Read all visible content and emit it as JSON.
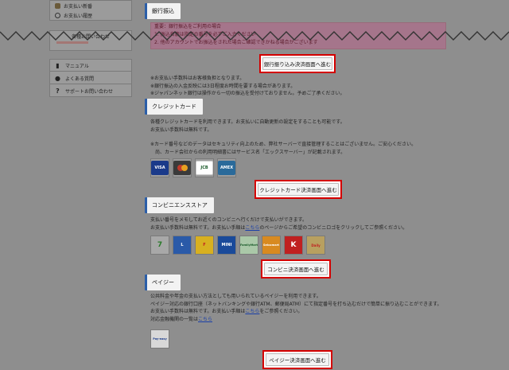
{
  "sidebar": {
    "top_items": [
      {
        "label": "お支払い新番",
        "icon": "wallet-icon"
      },
      {
        "label": "お支払い履歴",
        "icon": "clock-icon"
      }
    ],
    "box_title": "各種お問い合わせ",
    "menu": [
      {
        "label": "マニュアル",
        "icon": "book-icon",
        "glyph": "▮"
      },
      {
        "label": "よくある質問",
        "icon": "speech-bubble-icon",
        "glyph": "●"
      },
      {
        "label": "サポートお問い合わせ",
        "icon": "question-icon",
        "glyph": "?"
      }
    ]
  },
  "bank": {
    "heading": "銀行振込",
    "warning_lines": [
      "重要：銀行振込をご利用の場合",
      "1. 振込名義は指定の番号を必ずご入力ください",
      "2. 他のアカウントでお振込をされた場合ご確認できかねる場合がございます"
    ],
    "button": "銀行振り込み決済画面へ進む",
    "notes": [
      "※お支払い手数料はお客様負担となります。",
      "※銀行振込の入金反映には3日程度お時間を要する場合があります。",
      "※ジャパンネット銀行は操作から一切の振込を受付けておりません。予めご了承ください。"
    ]
  },
  "credit": {
    "heading": "クレジットカード",
    "lines": [
      "各種クレジットカードを利用できます。お支払いに自動更新の設定をすることも可能です。",
      "お支払い手数料は無料です。",
      "",
      "※カード番号などのデータはセキュリティ向上のため、弊社サーバーで直接管理することはございません。ご安心ください。",
      "　尚、カード会社からの利用明細書にはサービス名「エックスサーバー」が記載されます。"
    ],
    "brands": [
      "VISA",
      "MasterCard",
      "JCB",
      "AMEX"
    ],
    "button": "クレジットカード決済画面へ進む"
  },
  "conveni": {
    "heading": "コンビニエンスストア",
    "line1": "支払い番号をメモしてお近くのコンビニへ行くだけで支払いができます。",
    "line2_pre": "お支払い手数料は無料です。お支払い手順は",
    "line2_link": "こちら",
    "line2_post": "のページからご希望のコンビニロゴをクリックしてご参照ください。",
    "stores": [
      "7",
      "L",
      "F",
      "MINI",
      "FamilyMart",
      "Seicomart",
      "K",
      "Daily"
    ],
    "button": "コンビニ決済画面へ進む"
  },
  "payeasy": {
    "heading": "ペイジー",
    "line1": "公共料金や年金の支払い方法としても用いられているペイジーを利用できます。",
    "line2": "ペイジー対応の銀行口座（ネットバンキングや銀行ATM、郵便局ATM）にて指定番号を打ち込むだけで簡単に振り込むことができます。",
    "line3_pre": "お支払い手数料は無料です。お支払い手順は",
    "line3_link": "こちら",
    "line3_post": "をご参照ください。",
    "line4_pre": "対応金融機関の一覧は",
    "line4_link": "こちら",
    "line4_post": "",
    "logo": "Pay-easy",
    "button": "ペイジー決済画面へ進む"
  },
  "colors": {
    "accent": "#2b5ea8",
    "highlight": "#d40000",
    "overlay": "#8e8e8e"
  }
}
